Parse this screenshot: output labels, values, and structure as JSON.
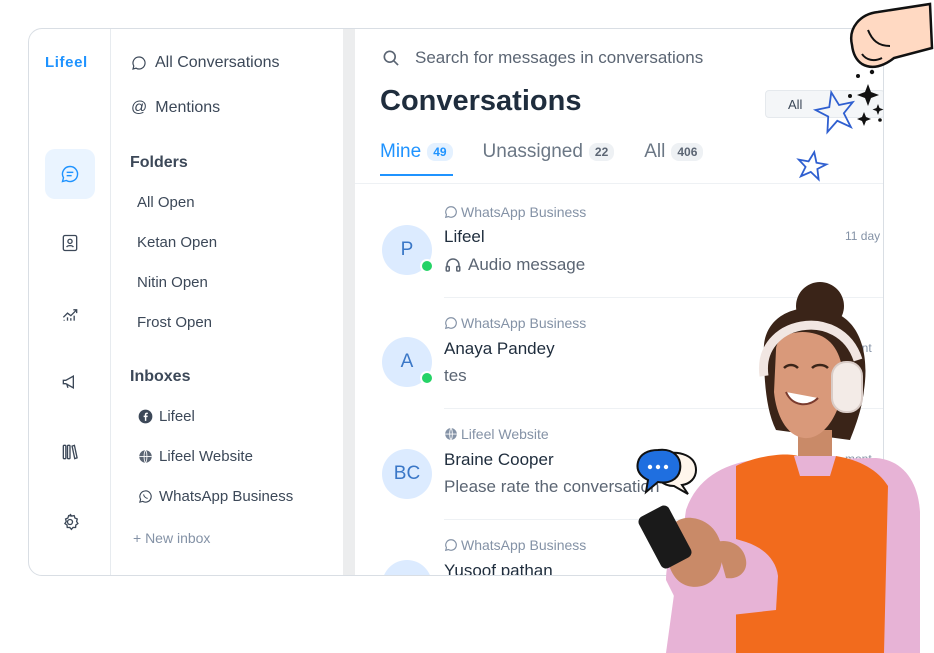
{
  "app": {
    "logo": "Lifeel"
  },
  "secondary": {
    "all_conversations": "All Conversations",
    "mentions": "Mentions",
    "folders_heading": "Folders",
    "folders": [
      "All Open",
      "Ketan Open",
      "Nitin Open",
      "Frost Open"
    ],
    "inboxes_heading": "Inboxes",
    "inboxes": [
      {
        "label": "Lifeel",
        "icon": "facebook-icon"
      },
      {
        "label": "Lifeel Website",
        "icon": "globe-icon"
      },
      {
        "label": "WhatsApp Business",
        "icon": "whatsapp-icon"
      }
    ],
    "new_inbox": "+ New inbox"
  },
  "main": {
    "search_placeholder": "Search for messages in conversations",
    "title": "Conversations",
    "filter_value": "All",
    "tabs": [
      {
        "label": "Mine",
        "count": "49"
      },
      {
        "label": "Unassigned",
        "count": "22"
      },
      {
        "label": "All",
        "count": "406"
      }
    ],
    "conversations": [
      {
        "inbox": "WhatsApp Business",
        "name": "Lifeel",
        "message": "Audio message",
        "avatar": "P",
        "time": "11 day"
      },
      {
        "inbox": "WhatsApp Business",
        "name": "Anaya Pandey",
        "message": "tes",
        "avatar": "A",
        "time": "mont"
      },
      {
        "inbox": "Lifeel Website",
        "name": "Braine Cooper",
        "message": "Please rate the conversation",
        "avatar": "BC",
        "time": "mont"
      },
      {
        "inbox": "WhatsApp Business",
        "name": "Yusoof pathan",
        "message": "",
        "avatar": "",
        "time": ""
      }
    ]
  },
  "colors": {
    "accent": "#1f93ff",
    "whatsapp": "#25d366",
    "person_top": "#f26b1d"
  }
}
